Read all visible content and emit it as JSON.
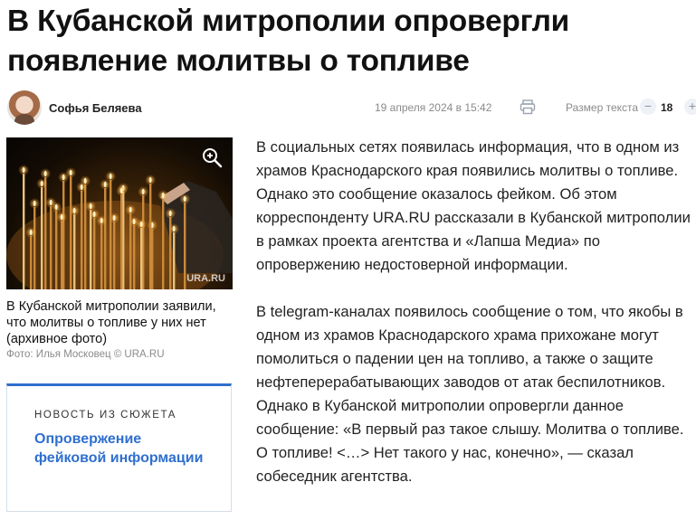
{
  "article": {
    "title": "В Кубанской митрополии опровергли появление молитвы о топливе",
    "author": "Софья Беляева",
    "date": "19 апреля 2024 в 15:42",
    "text_size_label": "Размер текста",
    "text_size_value": "18",
    "minus": "−",
    "plus": "+",
    "paragraphs": [
      "В социальных сетях появилась информация, что в одном из храмов Краснодарского края появились молитвы о топливе. Однако это сообщение оказалось фейком. Об этом корреспонденту URA.RU рассказали в Кубанской митрополии в рамках проекта агентства и «Лапша Медиа» по опровержению недостоверной информации.",
      "В telegram-каналах появилось сообщение о том, что якобы в одном из храмов Краснодарского храма прихожане могут помолиться о падении цен на топливо, а также о защите нефтеперерабатывающих заводов от атак беспилотников. Однако в Кубанской митрополии опровергли данное сообщение: «В первый раз такое слышу. Молитва о топливе. О топливе! <…> Нет такого у нас, конечно», — сказал собеседник агентства."
    ]
  },
  "photo": {
    "caption": "В Кубанской митрополии заявили, что молитвы о топливе у них нет (архивное фото)",
    "credit": "Фото: Илья Московец © URA.RU",
    "watermark": "URA.RU"
  },
  "story": {
    "label": "НОВОСТЬ ИЗ СЮЖЕТА",
    "link": "Опровержение фейковой информации"
  },
  "icons": {
    "print": "printer-icon",
    "zoom": "zoom-in-icon"
  },
  "colors": {
    "accent": "#2f6fcf",
    "muted": "#8a8a8a"
  }
}
